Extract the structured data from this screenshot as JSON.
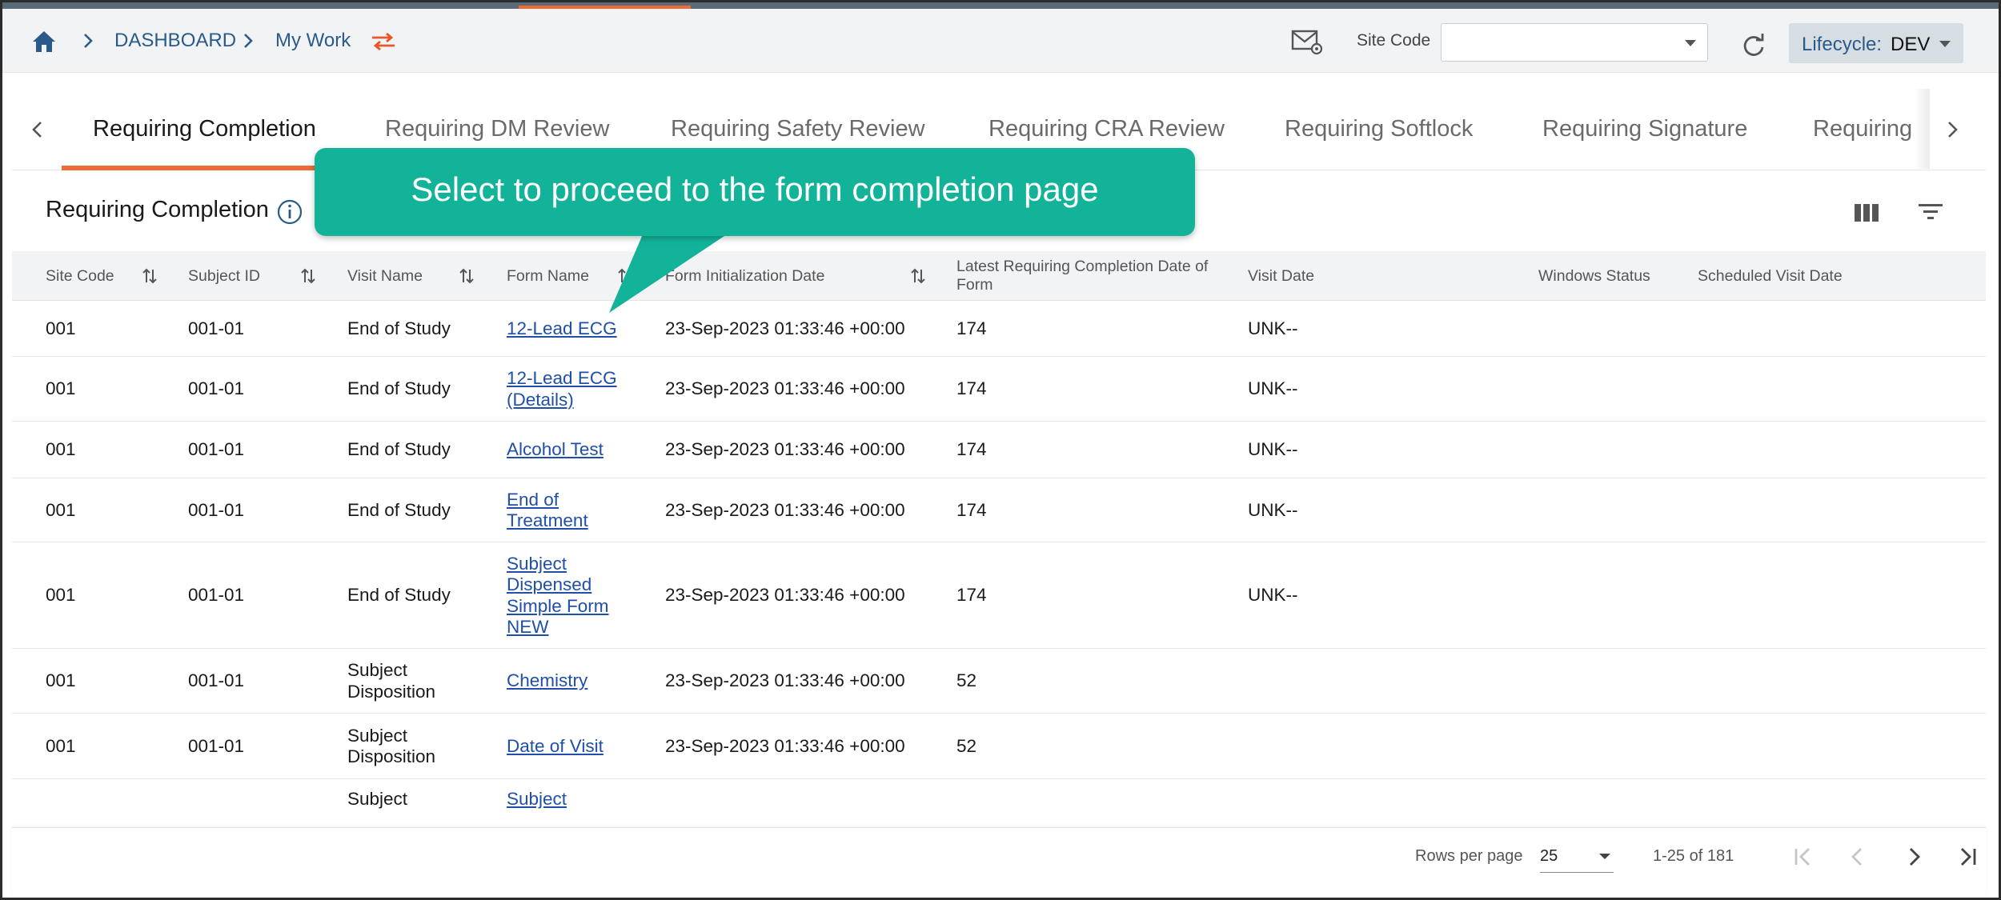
{
  "breadcrumb": {
    "level1": "DASHBOARD",
    "level2": "My Work"
  },
  "header": {
    "site_code_label": "Site Code",
    "site_code_value": "",
    "lifecycle_label": "Lifecycle:",
    "lifecycle_value": "DEV"
  },
  "tabs": [
    {
      "label": "Requiring Completion",
      "active": true
    },
    {
      "label": "Requiring DM Review"
    },
    {
      "label": "Requiring Safety Review"
    },
    {
      "label": "Requiring CRA Review"
    },
    {
      "label": "Requiring Softlock"
    },
    {
      "label": "Requiring Signature"
    },
    {
      "label": "Requiring"
    }
  ],
  "section": {
    "title": "Requiring Completion"
  },
  "table": {
    "headers": {
      "site_code": "Site Code",
      "subject_id": "Subject ID",
      "visit_name": "Visit Name",
      "form_name": "Form Name",
      "form_init_date": "Form Initialization Date",
      "latest_date_1": "Latest Requiring Completion Date of",
      "latest_date_2": "Form",
      "visit_date": "Visit Date",
      "windows_status": "Windows Status",
      "scheduled_visit_date": "Scheduled Visit Date"
    },
    "rows": [
      {
        "site": "001",
        "subject": "001-01",
        "visit": [
          "End of Study"
        ],
        "form": [
          "12-Lead ECG"
        ],
        "init": "23-Sep-2023 01:33:46 +00:00",
        "latest": "174",
        "visit_date": "UNK--"
      },
      {
        "site": "001",
        "subject": "001-01",
        "visit": [
          "End of Study"
        ],
        "form": [
          "12-Lead ECG",
          "(Details)"
        ],
        "init": "23-Sep-2023 01:33:46 +00:00",
        "latest": "174",
        "visit_date": "UNK--"
      },
      {
        "site": "001",
        "subject": "001-01",
        "visit": [
          "End of Study"
        ],
        "form": [
          "Alcohol Test"
        ],
        "init": "23-Sep-2023 01:33:46 +00:00",
        "latest": "174",
        "visit_date": "UNK--"
      },
      {
        "site": "001",
        "subject": "001-01",
        "visit": [
          "End of Study"
        ],
        "form": [
          "End of",
          "Treatment"
        ],
        "init": "23-Sep-2023 01:33:46 +00:00",
        "latest": "174",
        "visit_date": "UNK--"
      },
      {
        "site": "001",
        "subject": "001-01",
        "visit": [
          "End of Study"
        ],
        "form": [
          "Subject",
          "Dispensed",
          "Simple Form",
          "NEW"
        ],
        "init": "23-Sep-2023 01:33:46 +00:00",
        "latest": "174",
        "visit_date": "UNK--"
      },
      {
        "site": "001",
        "subject": "001-01",
        "visit": [
          "Subject",
          "Disposition"
        ],
        "form": [
          "Chemistry"
        ],
        "init": "23-Sep-2023 01:33:46 +00:00",
        "latest": "52",
        "visit_date": ""
      },
      {
        "site": "001",
        "subject": "001-01",
        "visit": [
          "Subject",
          "Disposition"
        ],
        "form": [
          "Date of Visit"
        ],
        "init": "23-Sep-2023 01:33:46 +00:00",
        "latest": "52",
        "visit_date": ""
      },
      {
        "site": "",
        "subject": "",
        "visit": [
          "Subject"
        ],
        "form": [
          "Subject"
        ],
        "init": "",
        "latest": "",
        "visit_date": ""
      }
    ]
  },
  "pagination": {
    "rows_per_page_label": "Rows per page",
    "rows_per_page": "25",
    "range": "1-25 of 181"
  },
  "callout": {
    "text": "Select to proceed to the form completion page"
  }
}
